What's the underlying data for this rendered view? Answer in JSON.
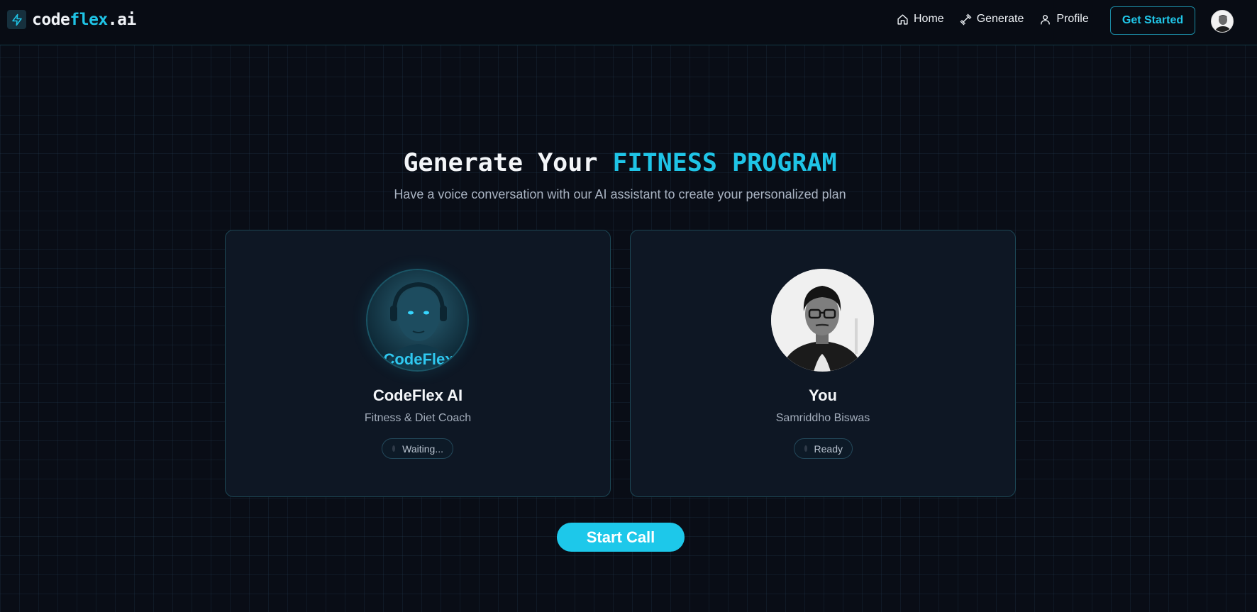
{
  "brand": {
    "prefix": "code",
    "accent": "flex",
    "suffix": ".ai"
  },
  "nav": {
    "items": [
      {
        "label": "Home",
        "icon": "home-icon"
      },
      {
        "label": "Generate",
        "icon": "dumbbell-icon"
      },
      {
        "label": "Profile",
        "icon": "user-icon"
      }
    ],
    "cta_label": "Get Started"
  },
  "hero": {
    "title_prefix": "Generate Your",
    "title_accent": "FITNESS PROGRAM",
    "subtitle": "Have a voice conversation with our AI assistant to create your personalized plan"
  },
  "cards": {
    "ai": {
      "name": "CodeFlex AI",
      "role": "Fitness & Diet Coach",
      "status": "Waiting...",
      "avatar_caption": "CodeFlex"
    },
    "user": {
      "name": "You",
      "role": "Samriddho Biswas",
      "status": "Ready"
    }
  },
  "actions": {
    "start_call_label": "Start Call"
  },
  "colors": {
    "accent": "#1fc4e6",
    "background": "#090d16",
    "card": "#0e1724",
    "border": "#1c4654"
  }
}
